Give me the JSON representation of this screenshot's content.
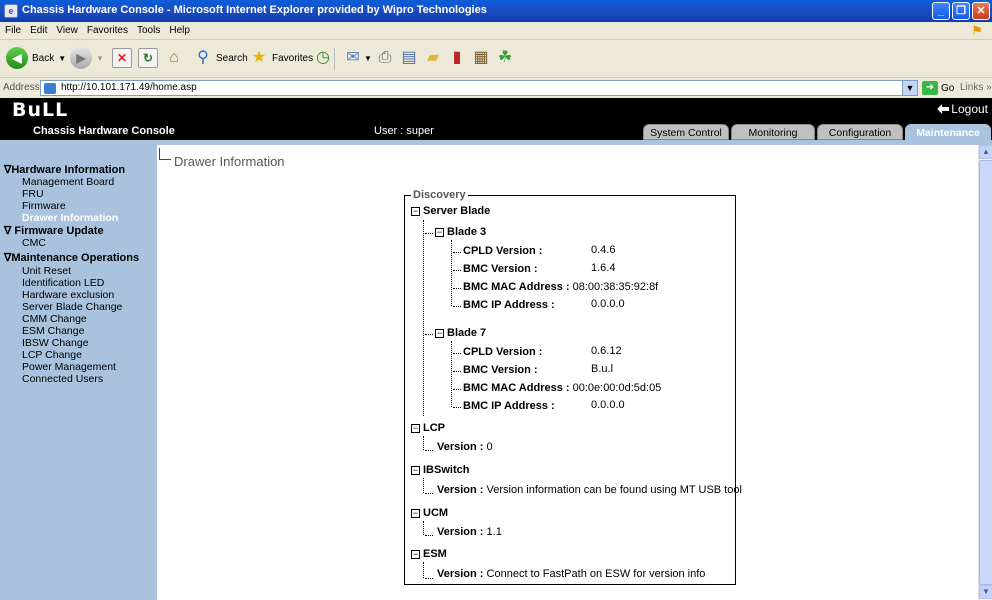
{
  "window": {
    "title": "Chassis Hardware Console - Microsoft Internet Explorer provided by Wipro Technologies"
  },
  "menu": [
    "File",
    "Edit",
    "View",
    "Favorites",
    "Tools",
    "Help"
  ],
  "toolbar": {
    "back": "Back",
    "search": "Search",
    "favorites": "Favorites"
  },
  "address": {
    "label": "Address",
    "url": "http://10.101.171.49/home.asp",
    "go": "Go",
    "links": "Links"
  },
  "header": {
    "logo": "BuLL",
    "logout": "Logout",
    "console_title": "Chassis Hardware Console",
    "user": "User : super",
    "tabs": [
      "System Control",
      "Monitoring",
      "Configuration",
      "Maintenance"
    ],
    "active_tab": "Maintenance"
  },
  "sidebar": {
    "groups": [
      {
        "label": "∇Hardware Information",
        "items": [
          "Management Board",
          "FRU",
          "Firmware",
          "Drawer Information"
        ]
      },
      {
        "label": "∇ Firmware Update",
        "items": [
          "CMC"
        ]
      },
      {
        "label": "∇Maintenance Operations",
        "items": [
          "Unit Reset",
          "Identification LED",
          "Hardware exclusion",
          "Server Blade Change",
          "CMM Change",
          "ESM Change",
          "IBSW Change",
          "LCP Change",
          "Power Management",
          "Connected Users"
        ]
      }
    ],
    "active_item": "Drawer Information"
  },
  "page": {
    "title": "Drawer Information",
    "discovery": {
      "legend": "Discovery",
      "server_blade": {
        "label": "Server Blade",
        "blades": [
          {
            "name": "Blade 3",
            "fields": [
              {
                "k": "CPLD Version :",
                "v": "0.4.6"
              },
              {
                "k": "BMC Version :",
                "v": "1.6.4"
              },
              {
                "k": "BMC MAC Address :",
                "v": "08:00:38:35:92:8f"
              },
              {
                "k": "BMC IP Address :",
                "v": "0.0.0.0"
              }
            ]
          },
          {
            "name": "Blade 7",
            "fields": [
              {
                "k": "CPLD Version :",
                "v": "0.6.12"
              },
              {
                "k": "BMC Version :",
                "v": "B.u.l"
              },
              {
                "k": "BMC MAC Address :",
                "v": "00:0e:00:0d:5d:05"
              },
              {
                "k": "BMC IP Address :",
                "v": "0.0.0.0"
              }
            ]
          }
        ]
      },
      "components": [
        {
          "label": "LCP",
          "k": "Version :",
          "v": "0"
        },
        {
          "label": "IBSwitch",
          "k": "Version :",
          "v": "Version information can be found using MT USB tool"
        },
        {
          "label": "UCM",
          "k": "Version :",
          "v": "1.1"
        },
        {
          "label": "ESM",
          "k": "Version :",
          "v": "Connect to FastPath on ESW for version info"
        }
      ]
    }
  }
}
